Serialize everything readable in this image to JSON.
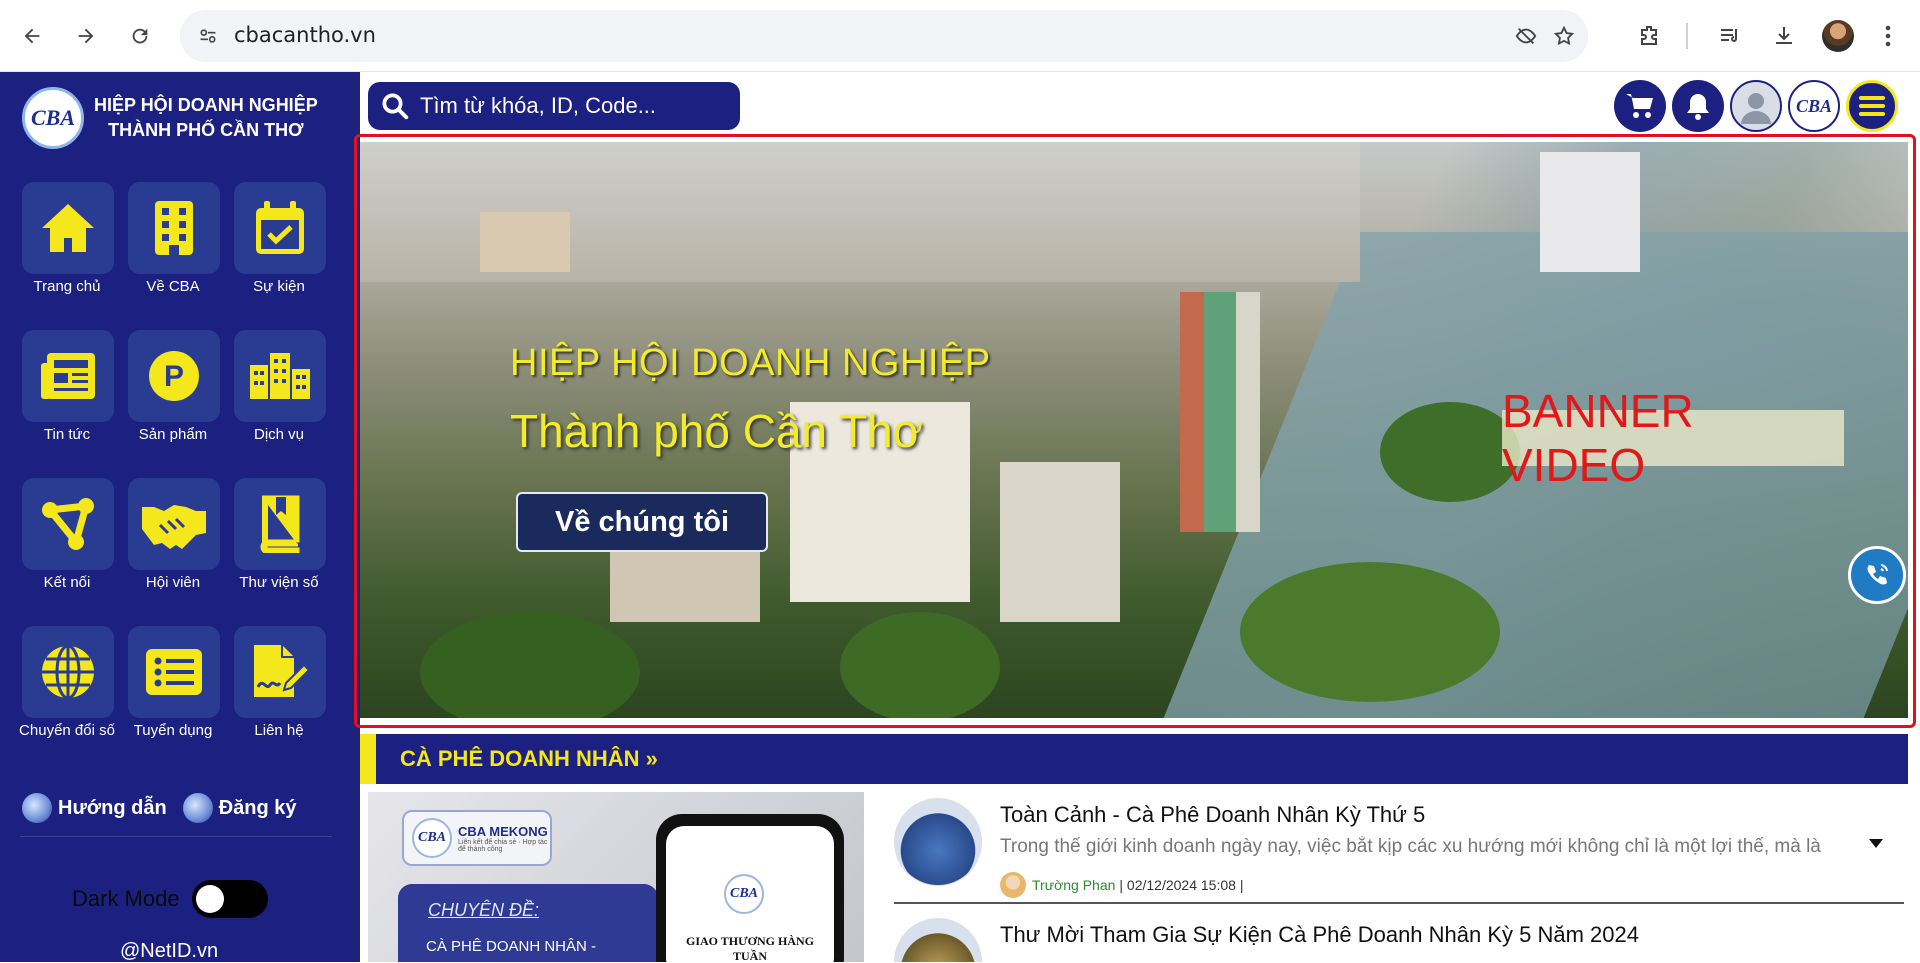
{
  "browser": {
    "url": "cbacantho.vn"
  },
  "sidebar": {
    "org_name_line1": "HIỆP HỘI DOANH NGHIỆP",
    "org_name_line2": "THÀNH PHỐ CẦN THƠ",
    "logo_text": "CBA",
    "items": [
      {
        "label": "Trang chủ",
        "icon": "home-icon"
      },
      {
        "label": "Về CBA",
        "icon": "building-icon"
      },
      {
        "label": "Sự kiện",
        "icon": "calendar-check-icon"
      },
      {
        "label": "Tin tức",
        "icon": "newspaper-icon"
      },
      {
        "label": "Sản phẩm",
        "icon": "product-p-icon"
      },
      {
        "label": "Dịch vụ",
        "icon": "city-icon"
      },
      {
        "label": "Kết nối",
        "icon": "network-icon"
      },
      {
        "label": "Hội viên",
        "icon": "handshake-icon"
      },
      {
        "label": "Thư viện số",
        "icon": "book-icon"
      },
      {
        "label": "Chuyển đổi số",
        "icon": "globe-icon"
      },
      {
        "label": "Tuyển dụng",
        "icon": "list-icon"
      },
      {
        "label": "Liên hệ",
        "icon": "signature-icon"
      }
    ],
    "guide_label": "Hướng dẫn",
    "register_label": "Đăng ký",
    "dark_mode_label": "Dark Mode",
    "footer_text": "@NetID.vn",
    "accent_color": "#f4e71b",
    "bg_color": "#1c2181"
  },
  "topbar": {
    "search_placeholder": "Tìm từ khóa, ID, Code...",
    "buttons": [
      "cart-icon",
      "bell-icon",
      "user-icon",
      "cba-logo",
      "menu-icon"
    ]
  },
  "banner": {
    "title_line1": "HIỆP HỘI DOANH NGHIỆP",
    "title_line2": "Thành phố Cần Thơ",
    "button_label": "Về chúng tôi",
    "overlay_label": "BANNER VIDEO",
    "frame_color": "#e01020"
  },
  "section": {
    "title": "CÀ PHÊ DOANH NHÂN »"
  },
  "promo": {
    "badge_title": "CBA MEKONG",
    "badge_sub": "Liên kết để chia sẻ · Hợp tác để thành công",
    "topic_label": "CHUYÊN ĐỀ:",
    "topic_text": "CÀ PHÊ DOANH NHÂN -",
    "phone_text": "GIAO THƯƠNG HÀNG TUẦN"
  },
  "news": [
    {
      "title": "Toàn Cảnh - Cà Phê Doanh Nhân Kỳ Thứ 5",
      "excerpt": "Trong thế giới kinh doanh ngày nay, việc bắt kịp các xu hướng mới không chỉ là một lợi thế, mà là",
      "author": "Trường Phan",
      "meta": "| 02/12/2024 15:08 |"
    },
    {
      "title": "Thư Mời Tham Gia Sự Kiện Cà Phê Doanh Nhân Kỳ 5 Năm 2024",
      "excerpt": "",
      "author": "",
      "meta": ""
    }
  ]
}
